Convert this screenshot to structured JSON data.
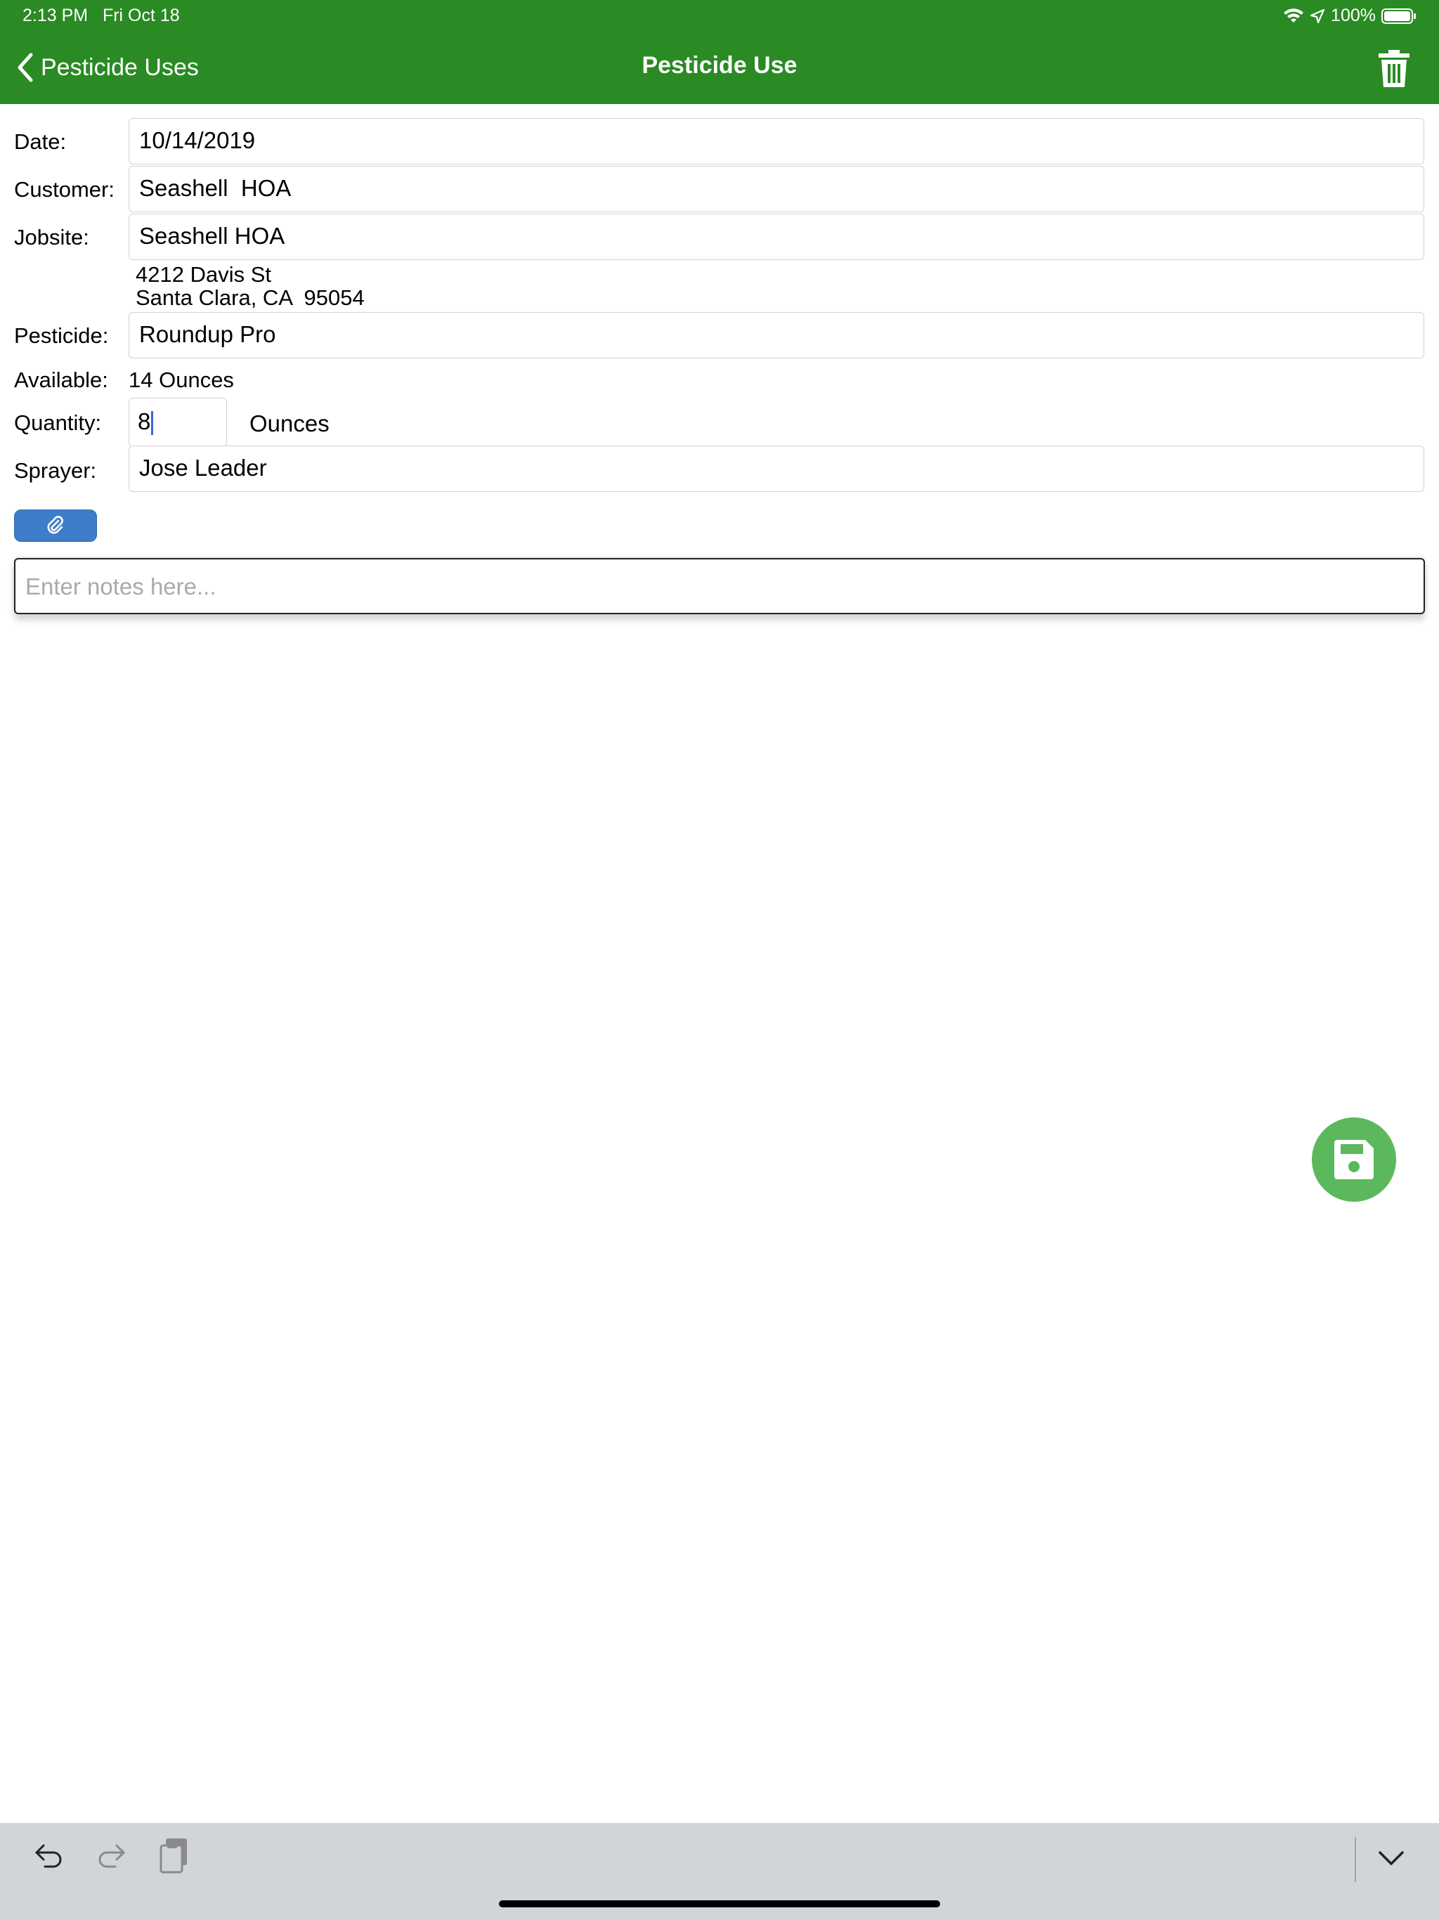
{
  "status_bar": {
    "time": "2:13 PM",
    "date": "Fri Oct 18",
    "battery": "100%"
  },
  "nav": {
    "back_label": "Pesticide Uses",
    "title": "Pesticide Use"
  },
  "form": {
    "date_label": "Date:",
    "date_value": "10/14/2019",
    "customer_label": "Customer:",
    "customer_value": "Seashell  HOA",
    "jobsite_label": "Jobsite:",
    "jobsite_value": "Seashell HOA",
    "address_line1": "4212 Davis St",
    "address_line2": "Santa Clara, CA  95054",
    "pesticide_label": "Pesticide:",
    "pesticide_value": "Roundup Pro",
    "available_label": "Available:",
    "available_value": "14 Ounces",
    "quantity_label": "Quantity:",
    "quantity_value": "8",
    "quantity_unit": "Ounces",
    "sprayer_label": "Sprayer:",
    "sprayer_value": "Jose Leader",
    "notes_placeholder": "Enter notes here..."
  },
  "colors": {
    "header_green": "#2a8a24",
    "fab_green": "#5cb85c",
    "attach_blue": "#3d7dc9",
    "keyboard_bar": "#d1d4d9"
  },
  "icons": {
    "back": "chevron-left-icon",
    "trash": "trash-icon",
    "attach": "paperclip-icon",
    "save": "floppy-disk-icon",
    "undo": "undo-icon",
    "redo": "redo-icon",
    "paste": "paste-icon",
    "dismiss": "chevron-down-icon"
  }
}
